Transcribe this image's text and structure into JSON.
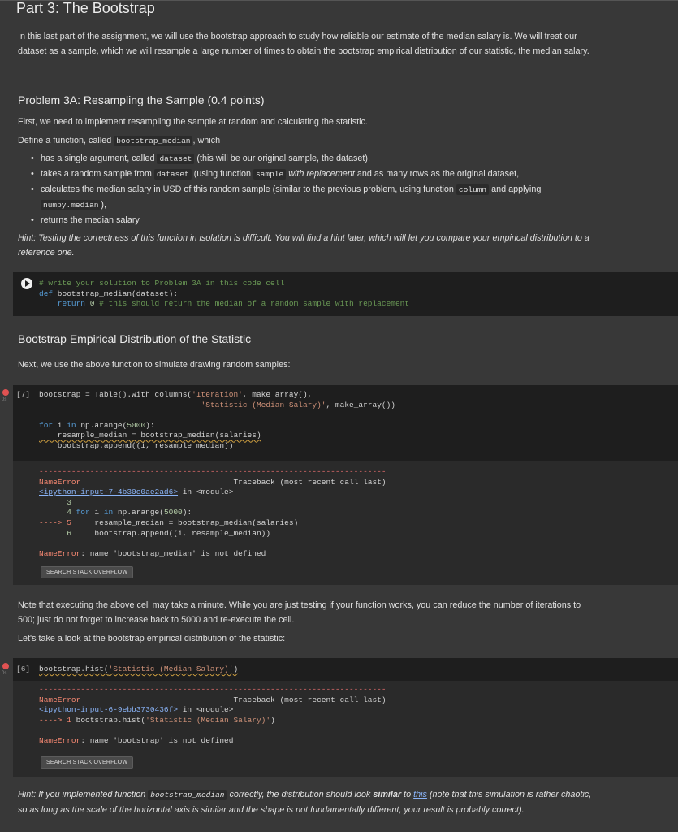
{
  "part_title": "Part 3: The Bootstrap",
  "intro_text": "In this last part of the assignment, we will use the bootstrap approach to study how reliable our estimate of the median salary is. We will treat our dataset as a sample, which we will resample a large number of times to obtain the bootstrap empirical distribution of our statistic, the median salary.",
  "problem_title": "Problem 3A: Resampling the Sample (0.4 points)",
  "problem_text": "First, we need to implement resampling the sample at random and calculating the statistic.",
  "define_pre": "Define a function, called ",
  "define_fn": "bootstrap_median",
  "define_post": ", which",
  "bullets": {
    "b1_pre": "has a single argument, called ",
    "b1_code": "dataset",
    "b1_post": " (this will be our original sample, the dataset),",
    "b2_pre": "takes a random sample from ",
    "b2_code": "dataset",
    "b2_mid": " (using function ",
    "b2_code2": "sample",
    "b2_italic": " with replacement",
    "b2_post": " and as many rows as the original dataset,",
    "b3_pre": "calculates the median salary in USD of this random sample (similar to the previous problem, using function ",
    "b3_code": "column",
    "b3_mid": " and applying ",
    "b3_code2": "numpy.median",
    "b3_post": "),",
    "b4": "returns the median salary."
  },
  "hint1": "Hint: Testing the correctness of this function in isolation is difficult. You will find a hint later, which will let you compare your empirical distribution to a reference one.",
  "cell1": {
    "line1": "# write your solution to Problem 3A in this code cell",
    "line2_kw": "def",
    "line2_rest": " bootstrap_median(dataset):",
    "line3_kw": "    return",
    "line3_num": " 0",
    "line3_cm": " # this should return the median of a random sample with replacement"
  },
  "section_title": "Bootstrap Empirical Distribution of the Statistic",
  "section_text": "Next, we use the above function to simulate drawing random samples:",
  "cell2": {
    "exec": "[7]",
    "time": "0s",
    "l1a": "bootstrap = Table().with_columns(",
    "l1b": "'Iteration'",
    "l1c": ", make_array(),",
    "l2a": "'Statistic (Median Salary)'",
    "l2b": ", make_array())",
    "l3a": "for",
    "l3b": " i ",
    "l3c": "in",
    "l3d": " np.arange(",
    "l3e": "5000",
    "l3f": "):",
    "l4": "    resample_median = bootstrap_median(salaries)",
    "l5": "    bootstrap.append((i, resample_median))"
  },
  "err1": {
    "dashes": "---------------------------------------------------------------------------",
    "name": "NameError",
    "tb": "Traceback (most recent call last)",
    "link": "<ipython-input-7-4b30c0ae2ad6>",
    "in_module": " in <module>",
    "ln3": "      3",
    "ln4a": "      4 ",
    "ln4b": "for",
    "ln4c": " i ",
    "ln4d": "in",
    "ln4e": " np.arange(",
    "ln4f": "5000",
    "ln4g": "):",
    "ln5a": "----> 5",
    "ln5b": "     resample_median = bootstrap_median(salaries)",
    "ln6a": "      6",
    "ln6b": "     bootstrap.append((i, resample_median))",
    "msg_name": "NameError",
    "msg": ": name 'bootstrap_median' is not defined",
    "button": "SEARCH STACK OVERFLOW"
  },
  "note_text": "Note that executing the above cell may take a minute. While you are just testing if your function works, you can reduce the number of iterations to 500; just do not forget to increase back to 5000 and re-execute the cell.",
  "look_text": "Let's take a look at the bootstrap empirical distribution of the statistic:",
  "cell3": {
    "exec": "[6]",
    "time": "0s",
    "code_a": "bootstrap.hist(",
    "code_b": "'Statistic (Median Salary)'",
    "code_c": ")"
  },
  "err2": {
    "dashes": "---------------------------------------------------------------------------",
    "name": "NameError",
    "tb": "Traceback (most recent call last)",
    "link": "<ipython-input-6-9ebb3730436f>",
    "in_module": " in <module>",
    "ln1a": "----> 1",
    "ln1b": " bootstrap.hist(",
    "ln1c": "'Statistic (Median Salary)'",
    "ln1d": ")",
    "msg_name": "NameError",
    "msg": ": name 'bootstrap' is not defined",
    "button": "SEARCH STACK OVERFLOW"
  },
  "hint2": {
    "pre": "Hint: If you implemented function ",
    "code": "bootstrap_median",
    "mid": " correctly, the distribution should look ",
    "bold": "similar",
    "mid2": " to ",
    "link": "this",
    "post": " (note that this simulation is rather chaotic, so as long as the scale of the horizontal axis is similar and the shape is not fundamentally different, your result is probably correct)."
  }
}
